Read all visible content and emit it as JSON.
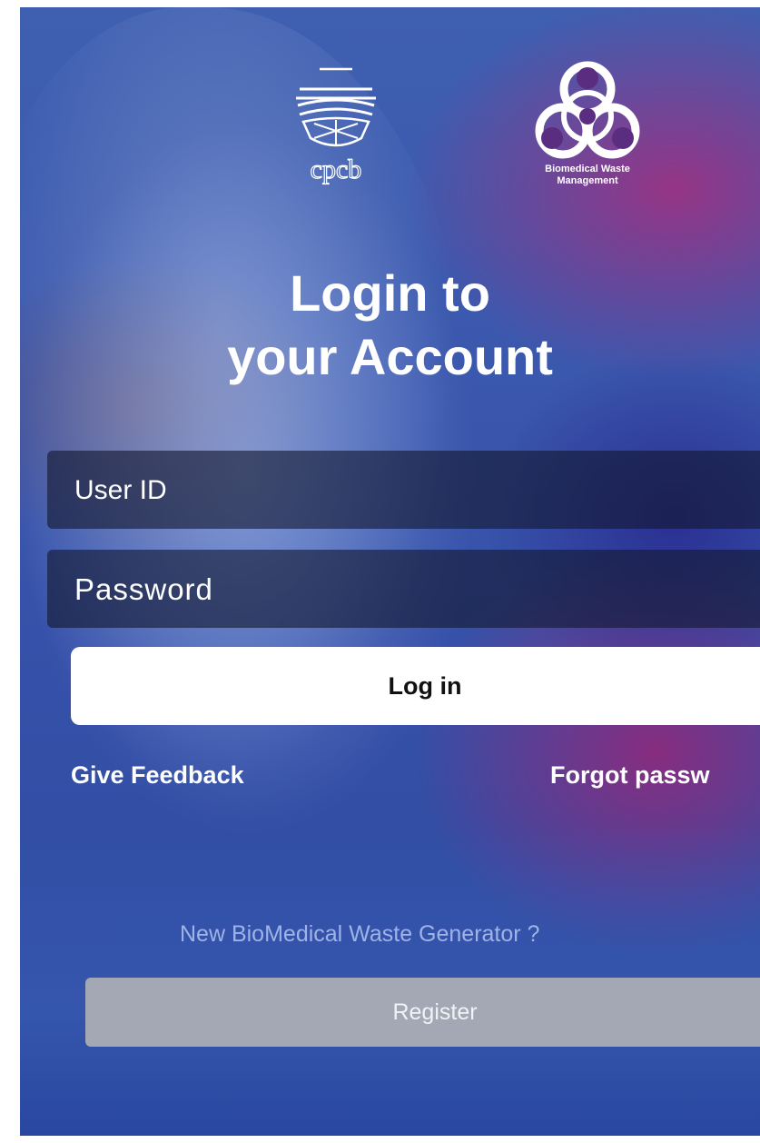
{
  "brand": {
    "cpcb_logo_label": "cpcb",
    "bmw_logo_caption": "Biomedical Waste\nManagement",
    "bmw_icon": "biohazard-icon"
  },
  "heading": {
    "line1": "Login to",
    "line2": "your Account"
  },
  "form": {
    "user_id_placeholder": "User ID",
    "password_placeholder": "Password",
    "login_label": "Log in"
  },
  "links": {
    "feedback": "Give Feedback",
    "forgot": "Forgot passw"
  },
  "register": {
    "prompt": "New BioMedical Waste Generator ?",
    "button_label": "Register"
  },
  "colors": {
    "background": "#3a57ad",
    "field_background": "#14182f",
    "login_button": "#ffffff",
    "register_button": "#a3a8b4",
    "prompt_text": "#9fb3e6"
  }
}
